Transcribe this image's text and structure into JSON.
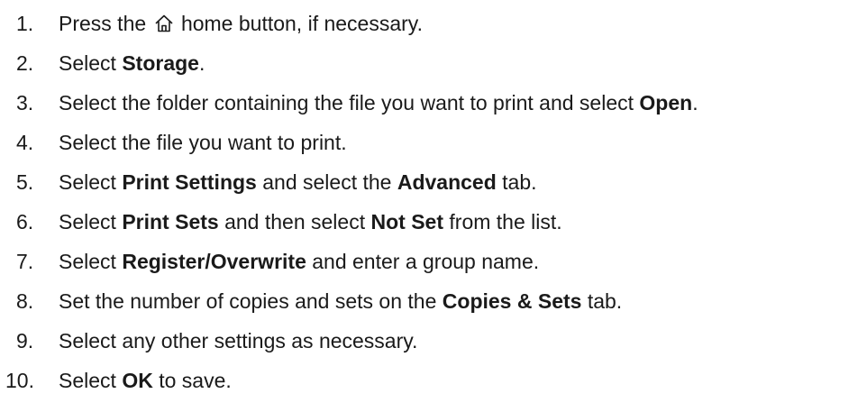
{
  "steps": [
    {
      "number": "1.",
      "before": "Press the",
      "icon": "home-icon",
      "after": "home button, if necessary."
    },
    {
      "number": "2.",
      "before": "Select ",
      "bold1": "Storage",
      "after": "."
    },
    {
      "number": "3.",
      "before": "Select the folder containing the file you want to print and select ",
      "bold1": "Open",
      "after": "."
    },
    {
      "number": "4.",
      "text": "Select the file you want to print."
    },
    {
      "number": "5.",
      "before": "Select ",
      "bold1": "Print Settings",
      "middle": " and select the ",
      "bold2": "Advanced",
      "after": " tab."
    },
    {
      "number": "6.",
      "before": "Select ",
      "bold1": "Print Sets",
      "middle": " and then select ",
      "bold2": "Not Set",
      "after": " from the list."
    },
    {
      "number": "7.",
      "before": "Select ",
      "bold1": "Register/Overwrite",
      "after": " and enter a group name."
    },
    {
      "number": "8.",
      "before": "Set the number of copies and sets on the ",
      "bold1": "Copies & Sets",
      "after": " tab."
    },
    {
      "number": "9.",
      "text": "Select any other settings as necessary."
    },
    {
      "number": "10.",
      "before": "Select ",
      "bold1": "OK",
      "after": " to save."
    }
  ]
}
